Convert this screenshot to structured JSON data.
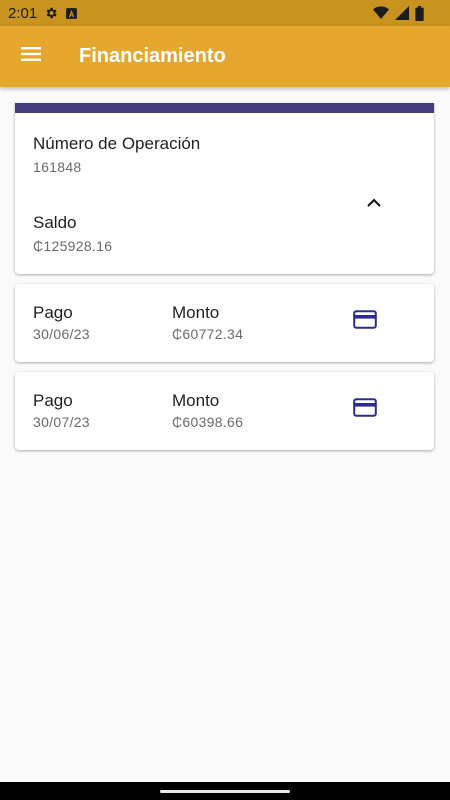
{
  "status_bar": {
    "time": "2:01",
    "icons": [
      "gear-icon",
      "font-icon",
      "wifi-icon",
      "signal-icon",
      "battery-icon"
    ]
  },
  "app_bar": {
    "title": "Financiamiento",
    "menu_icon": "menu-icon",
    "background": "#e5a72d"
  },
  "summary": {
    "accent_color": "#433b7c",
    "operation_label": "Número de Operación",
    "operation_value": "161848",
    "balance_label": "Saldo",
    "balance_value": "₵125928.16",
    "toggle_icon": "chevron-up-icon"
  },
  "payments": [
    {
      "date_label": "Pago",
      "date": "30/06/23",
      "amount_label": "Monto",
      "amount": "₵60772.34",
      "icon": "credit-card-icon"
    },
    {
      "date_label": "Pago",
      "date": "30/07/23",
      "amount_label": "Monto",
      "amount": "₵60398.66",
      "icon": "credit-card-icon"
    }
  ]
}
